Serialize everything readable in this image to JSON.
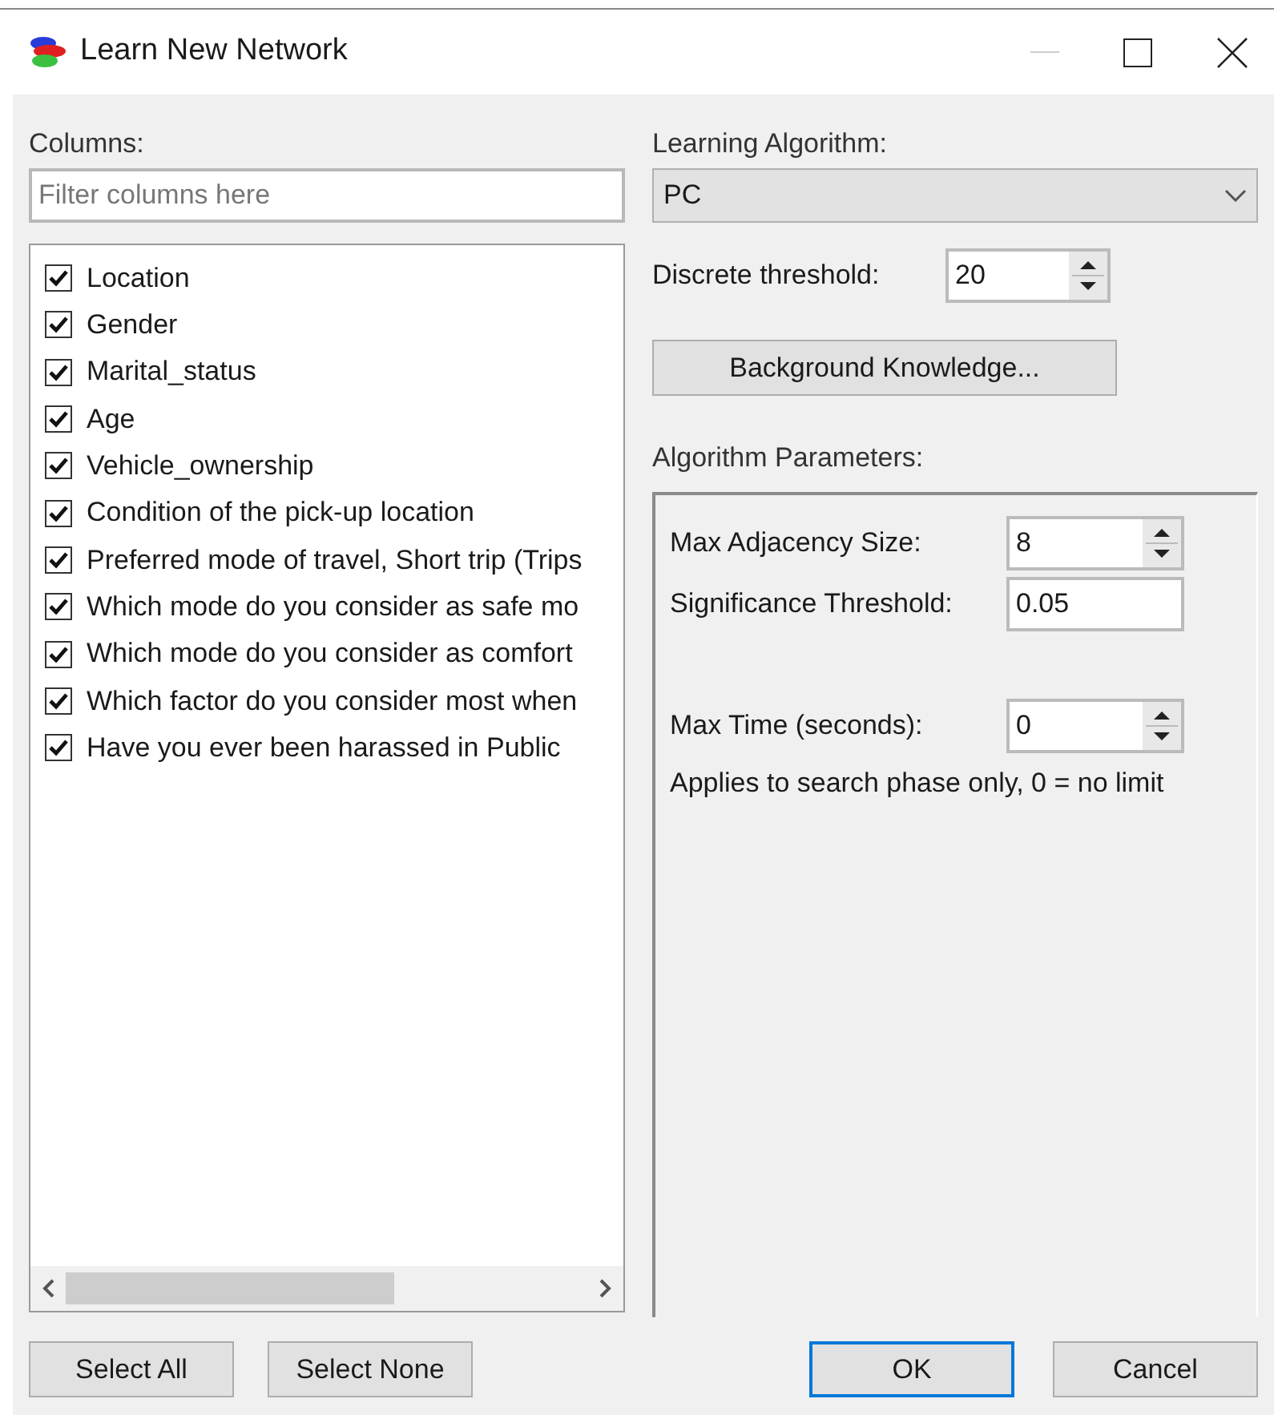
{
  "window": {
    "title": "Learn New Network"
  },
  "columns": {
    "label": "Columns:",
    "filter": {
      "placeholder": "Filter columns here"
    },
    "items": [
      {
        "label": "Location",
        "checked": true
      },
      {
        "label": "Gender",
        "checked": true
      },
      {
        "label": "Marital_status",
        "checked": true
      },
      {
        "label": "Age",
        "checked": true
      },
      {
        "label": "Vehicle_ownership",
        "checked": true
      },
      {
        "label": "Condition of the pick-up location",
        "checked": true
      },
      {
        "label": "Preferred mode of travel, Short trip (Trips",
        "checked": true
      },
      {
        "label": "Which mode do you consider as safe mo",
        "checked": true
      },
      {
        "label": "Which mode do you consider as comfort",
        "checked": true
      },
      {
        "label": "Which factor do you consider most when",
        "checked": true
      },
      {
        "label": "Have you ever been harassed in Public",
        "checked": true
      }
    ]
  },
  "algorithm": {
    "label": "Learning Algorithm:",
    "value": "PC"
  },
  "discrete_threshold": {
    "label": "Discrete threshold:",
    "value": "20"
  },
  "background_button": "Background Knowledge...",
  "parameters": {
    "label": "Algorithm Parameters:",
    "fields": [
      {
        "kind": "spin",
        "label": "Max Adjacency Size:",
        "value": "8"
      },
      {
        "kind": "text",
        "label": "Significance Threshold:",
        "value": "0.05"
      },
      {
        "kind": "gap"
      },
      {
        "kind": "spin",
        "label": "Max Time (seconds):",
        "value": "0"
      }
    ],
    "note": "Applies to search phase only, 0 = no limit"
  },
  "buttons": [
    {
      "label": "Select All",
      "kind": "left",
      "default": false
    },
    {
      "label": "Select None",
      "kind": "left",
      "default": false
    },
    {
      "label": "OK",
      "kind": "right",
      "default": true
    },
    {
      "label": "Cancel",
      "kind": "right",
      "default": false
    }
  ]
}
